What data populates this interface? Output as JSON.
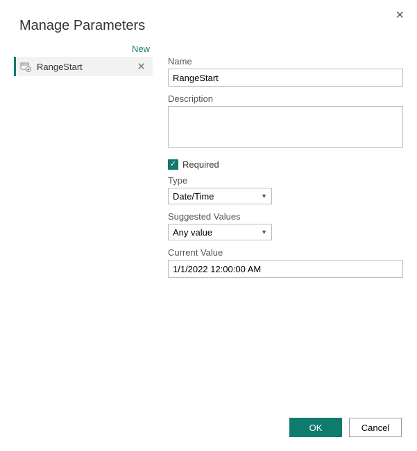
{
  "dialogTitle": "Manage Parameters",
  "newLink": "New",
  "sidebar": {
    "items": [
      {
        "name": "RangeStart"
      }
    ]
  },
  "labels": {
    "name": "Name",
    "description": "Description",
    "required": "Required",
    "type": "Type",
    "suggestedValues": "Suggested Values",
    "currentValue": "Current Value"
  },
  "values": {
    "name": "RangeStart",
    "description": "",
    "requiredChecked": true,
    "type": "Date/Time",
    "suggestedValues": "Any value",
    "currentValue": "1/1/2022 12:00:00 AM"
  },
  "buttons": {
    "ok": "OK",
    "cancel": "Cancel"
  }
}
